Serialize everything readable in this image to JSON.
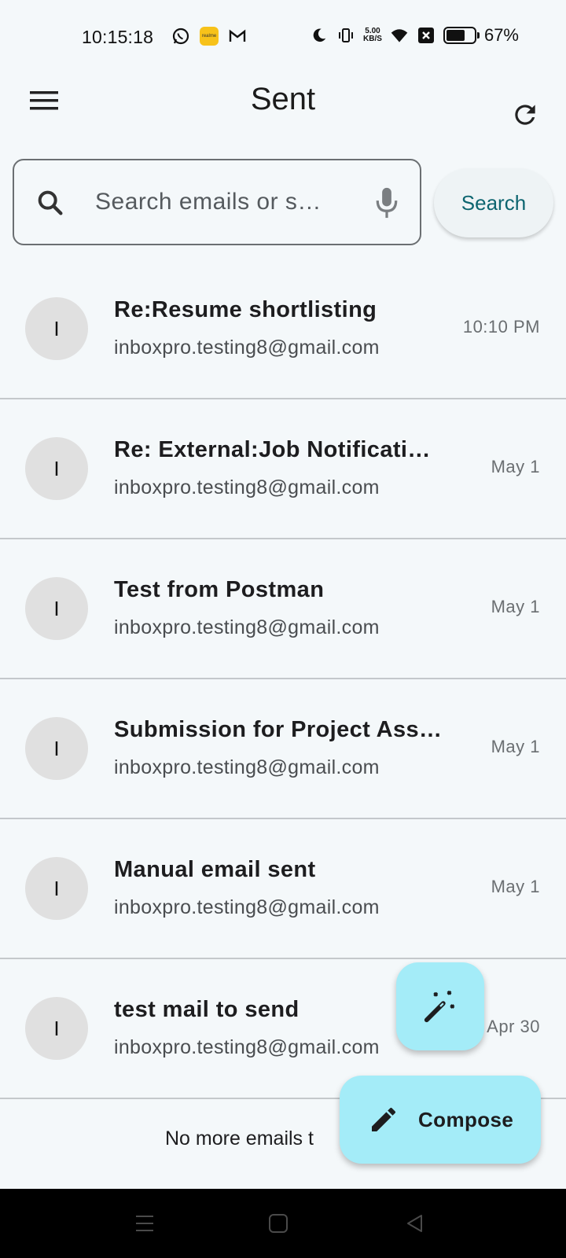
{
  "status_bar": {
    "time": "10:15:18",
    "net_speed_value": "5.00",
    "net_speed_unit": "KB/S",
    "battery_percent": "67%",
    "battery_level": 0.67,
    "icons": [
      "whatsapp-icon",
      "realme-icon",
      "gmail-icon",
      "moon-icon",
      "vibrate-icon",
      "wifi-icon",
      "notification-x-icon",
      "battery-icon"
    ]
  },
  "app_bar": {
    "title": "Sent",
    "menu_icon": "menu-icon",
    "refresh_icon": "refresh-icon"
  },
  "search": {
    "placeholder": "Search emails or s…",
    "button_label": "Search"
  },
  "emails": [
    {
      "avatar": "I",
      "subject": "Re:Resume shortlisting",
      "sender": "inboxpro.testing8@gmail.com",
      "date": "10:10 PM"
    },
    {
      "avatar": "I",
      "subject": "Re: External:Job Notificati…",
      "sender": "inboxpro.testing8@gmail.com",
      "date": "May 1"
    },
    {
      "avatar": "I",
      "subject": "Test from Postman",
      "sender": "inboxpro.testing8@gmail.com",
      "date": "May 1"
    },
    {
      "avatar": "I",
      "subject": "Submission for Project Ass…",
      "sender": "inboxpro.testing8@gmail.com",
      "date": "May 1"
    },
    {
      "avatar": "I",
      "subject": "Manual email sent",
      "sender": "inboxpro.testing8@gmail.com",
      "date": "May 1"
    },
    {
      "avatar": "I",
      "subject": "test mail to send",
      "sender": "inboxpro.testing8@gmail.com",
      "date": "Apr 30"
    }
  ],
  "footer": {
    "text": "No more emails t"
  },
  "fab": {
    "magic_icon": "magic-wand-icon",
    "compose_label": "Compose",
    "compose_icon": "pencil-icon"
  },
  "colors": {
    "background": "#f4f8fa",
    "fab": "#a4ecf8",
    "accent": "#0d6570"
  }
}
